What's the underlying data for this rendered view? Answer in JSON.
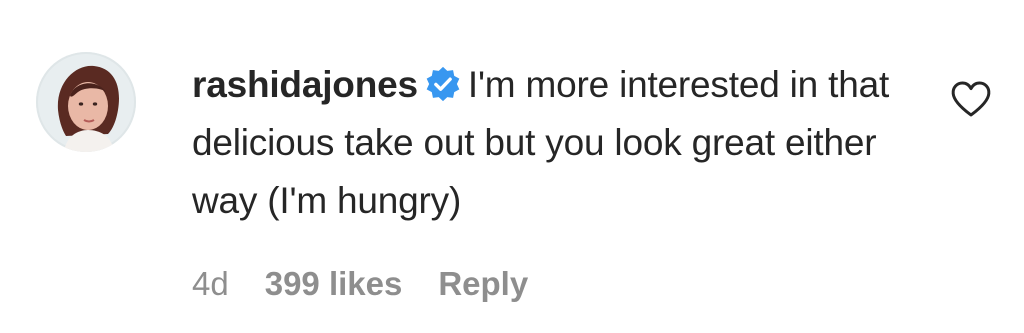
{
  "comment": {
    "username": "rashidajones",
    "verified_icon": "verified-badge-icon",
    "text": "I'm more interested in that delicious take out but you look great either way (I'm hungry)",
    "time": "4d",
    "likes": "399 likes",
    "reply_label": "Reply",
    "like_icon": "heart-outline-icon",
    "accent_color": "#3897f0",
    "muted_color": "#8e8e8e"
  }
}
